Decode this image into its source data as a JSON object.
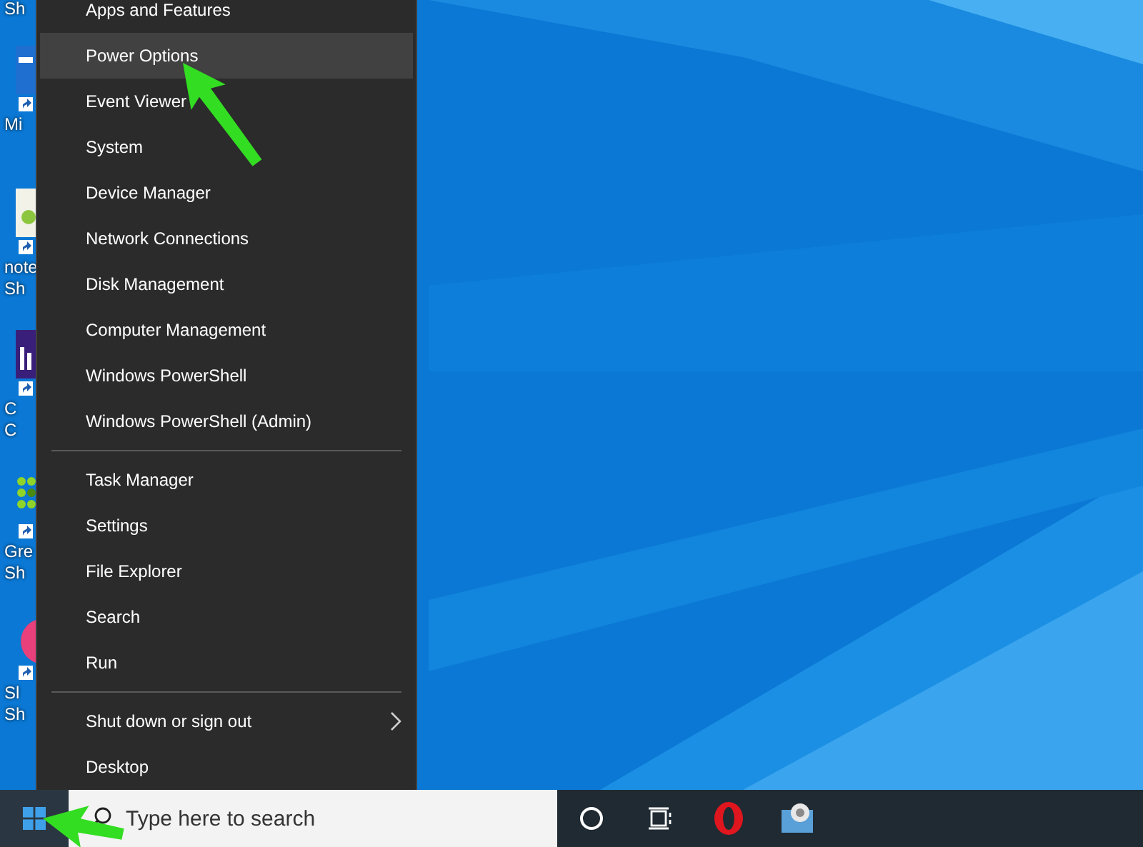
{
  "desktop_icons": [
    {
      "kind": "none",
      "label_lines": [
        "Sh"
      ]
    },
    {
      "kind": "app",
      "label_lines": [
        "Mi"
      ]
    },
    {
      "kind": "notepad",
      "label_lines": [
        "note",
        "Sh"
      ]
    },
    {
      "kind": "media",
      "label_lines": [
        "C",
        "C"
      ]
    },
    {
      "kind": "dots",
      "label_lines": [
        "Gre",
        "Sh"
      ]
    },
    {
      "kind": "circle",
      "label_lines": [
        "Sl",
        "Sh"
      ]
    }
  ],
  "context_menu": {
    "groups": [
      {
        "items": [
          {
            "label": "Apps and Features",
            "selected": false,
            "has_submenu": false
          },
          {
            "label": "Power Options",
            "selected": true,
            "has_submenu": false
          },
          {
            "label": "Event Viewer",
            "selected": false,
            "has_submenu": false
          },
          {
            "label": "System",
            "selected": false,
            "has_submenu": false
          },
          {
            "label": "Device Manager",
            "selected": false,
            "has_submenu": false
          },
          {
            "label": "Network Connections",
            "selected": false,
            "has_submenu": false
          },
          {
            "label": "Disk Management",
            "selected": false,
            "has_submenu": false
          },
          {
            "label": "Computer Management",
            "selected": false,
            "has_submenu": false
          },
          {
            "label": "Windows PowerShell",
            "selected": false,
            "has_submenu": false
          },
          {
            "label": "Windows PowerShell (Admin)",
            "selected": false,
            "has_submenu": false
          }
        ]
      },
      {
        "items": [
          {
            "label": "Task Manager",
            "selected": false,
            "has_submenu": false
          },
          {
            "label": "Settings",
            "selected": false,
            "has_submenu": false
          },
          {
            "label": "File Explorer",
            "selected": false,
            "has_submenu": false
          },
          {
            "label": "Search",
            "selected": false,
            "has_submenu": false
          },
          {
            "label": "Run",
            "selected": false,
            "has_submenu": false
          }
        ]
      },
      {
        "items": [
          {
            "label": "Shut down or sign out",
            "selected": false,
            "has_submenu": true
          },
          {
            "label": "Desktop",
            "selected": false,
            "has_submenu": false
          }
        ]
      }
    ]
  },
  "taskbar": {
    "search": {
      "placeholder": "Type here to search"
    },
    "apps": [
      {
        "kind": "cortana"
      },
      {
        "kind": "task_view"
      },
      {
        "kind": "opera"
      },
      {
        "kind": "camera"
      }
    ]
  }
}
